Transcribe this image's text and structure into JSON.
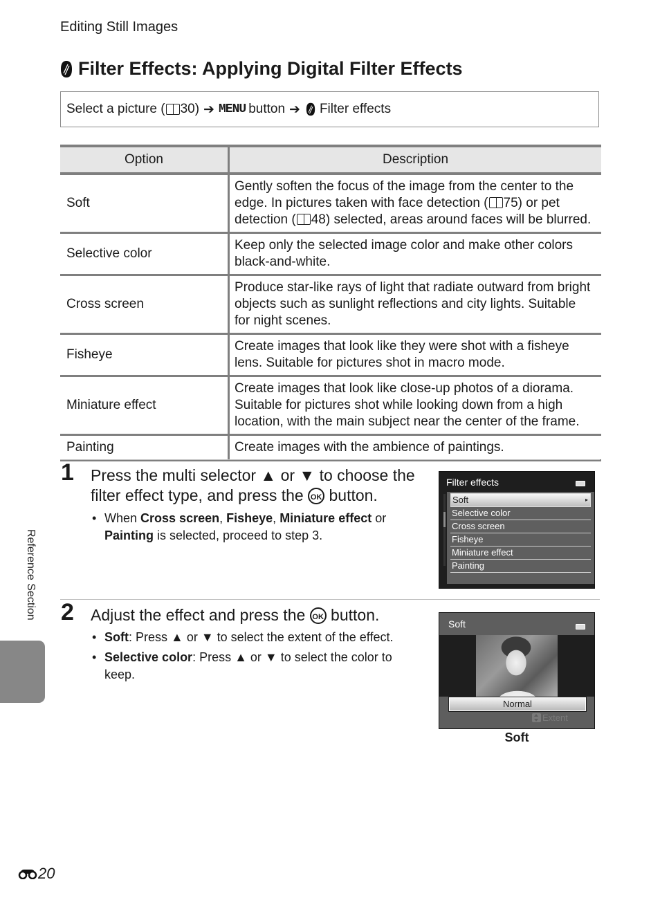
{
  "header": {
    "section_label": "Editing Still Images"
  },
  "title": {
    "icon": "filter-effects-icon",
    "text": "Filter Effects: Applying Digital Filter Effects"
  },
  "nav_path": {
    "part1": "Select a picture (",
    "ref_icon": "book-icon",
    "ref_page": "30",
    "part2": ")",
    "arrow": "➔",
    "menu_label": "MENU",
    "part3": "button",
    "filter_label": "Filter effects"
  },
  "table": {
    "headers": {
      "option": "Option",
      "description": "Description"
    },
    "rows": [
      {
        "option": "Soft",
        "description": " Gently soften the focus of the image from the center to the edge. In pictures taken with face detection (📖75) or pet detection (📖48) selected, areas around faces will be blurred.",
        "desc_parts": [
          " Gently soften the focus of the image from the center to the edge. In pictures taken with face detection (",
          "75",
          ") or pet detection (",
          "48",
          ") selected, areas around faces will be blurred."
        ]
      },
      {
        "option": "Selective color",
        "description": "Keep only the selected image color and make other colors black-and-white."
      },
      {
        "option": "Cross screen",
        "description": "Produce star-like rays of light that radiate outward from bright objects such as sunlight reflections and city lights. Suitable for night scenes."
      },
      {
        "option": "Fisheye",
        "description": "Create images that look like they were shot with a fisheye lens. Suitable for pictures shot in macro mode."
      },
      {
        "option": "Miniature effect",
        "description": "Create images that look like close-up photos of a diorama. Suitable for pictures shot while looking down from a high location, with the main subject near the center of the frame."
      },
      {
        "option": "Painting",
        "description": "Create images with the ambience of paintings."
      }
    ]
  },
  "step1": {
    "number": "1",
    "text_a": "Press the multi selector ▲ or ▼ to choose the filter effect type, and press the ",
    "ok": "OK",
    "text_b": " button.",
    "bullet": {
      "pre": "When ",
      "b1": "Cross screen",
      "s1": ", ",
      "b2": "Fisheye",
      "s2": ", ",
      "b3": "Miniature effect",
      "s3": " or ",
      "b4": "Painting",
      "post": " is selected, proceed to step 3."
    }
  },
  "screen1": {
    "title": "Filter effects",
    "items": [
      "Soft",
      "Selective color",
      "Cross screen",
      "Fisheye",
      "Miniature effect",
      "Painting"
    ],
    "selected_index": 0,
    "submenu_arrow": "▸"
  },
  "step2": {
    "number": "2",
    "text_a": "Adjust the effect and press the ",
    "ok": "OK",
    "text_b": " button.",
    "bullets": [
      {
        "bold": "Soft",
        "text": ": Press ▲ or ▼ to select the extent of the effect."
      },
      {
        "bold": "Selective color",
        "text": ": Press ▲ or ▼ to select the color to keep."
      }
    ]
  },
  "screen2": {
    "title": "Soft",
    "value": "Normal",
    "hint": "Extent",
    "caption": "Soft"
  },
  "sidebar": {
    "label": "Reference Section"
  },
  "footer": {
    "page_prefix_icon": "binoculars-reference-icon",
    "page_number": "20"
  },
  "colors": {
    "table_border": "#7f7f7f",
    "table_header_bg": "#e6e6e6",
    "side_tab": "#878787",
    "camera_bg": "#1e1e1e",
    "camera_menu_bg": "#5f5f5f"
  }
}
